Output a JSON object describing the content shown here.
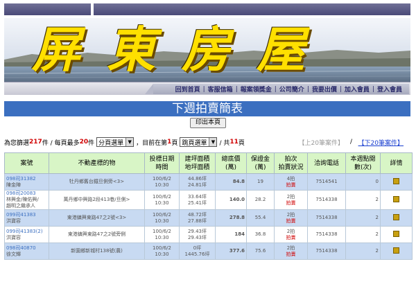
{
  "banner": {
    "title": "屏東房屋"
  },
  "nav": {
    "items": [
      "回到首頁",
      "客服信箱",
      "報案領獎金",
      "公司簡介",
      "我要出價",
      "加入會員",
      "登入會員"
    ]
  },
  "heading": "下週拍賣簡表",
  "print_button": "印出本頁",
  "info": {
    "prefix": "為您篩選",
    "total": "217",
    "mid1": "件 / 每頁最多",
    "per_page": "20",
    "mid2": "件",
    "page_select": "分頁選單",
    "mid3": "，目前在第",
    "current_page": "1",
    "mid4": "頁",
    "jump_select": "跳頁選單",
    "mid5": "/ 共",
    "total_pages": "11",
    "mid6": "頁",
    "prev": "【上20筆案件】",
    "sep": "/",
    "next": "【下20筆案件】"
  },
  "table": {
    "headers": [
      "案號",
      "不動產標的物",
      "投標日期\n時間",
      "建坪面積\n地坪面積",
      "總底價\n(萬)",
      "保證金\n(萬)",
      "拍次\n拍賣狀況",
      "洽詢電話",
      "本週點閱\n數(次)",
      "詳情"
    ],
    "rows": [
      {
        "case": "098司31382",
        "owner": "陳金陣",
        "property": "牡丹鄉舊台鐵旦側旁<3>",
        "date": "100/6/2",
        "time": "10:30",
        "build": "44.86坪",
        "land": "24.81坪",
        "price": "84.8",
        "deposit": "19",
        "round": "4拍",
        "status": "拍賣",
        "phone": "7514541",
        "visits": "0"
      },
      {
        "case": "098司20083",
        "owner": "林興金/陳佑興/\n趙明之繼承人",
        "property": "萬丹鄉中興路2段413巷/旦側>",
        "date": "100/6/2",
        "time": "10:30",
        "build": "33.64坪",
        "land": "25.41坪",
        "price": "140.0",
        "deposit": "28.2",
        "round": "2拍",
        "status": "拍賣",
        "phone": "7514338",
        "visits": "2"
      },
      {
        "case": "099司41383",
        "owner": "洪寶容",
        "property": "東港鎮興東路47之2號<3>",
        "date": "100/6/2",
        "time": "10:30",
        "build": "48.72坪",
        "land": "27.88坪",
        "price": "278.8",
        "deposit": "55.4",
        "round": "2拍",
        "status": "拍賣",
        "phone": "7514338",
        "visits": "2"
      },
      {
        "case": "099司41383(2)",
        "owner": "洪寶容",
        "property": "東港鎮興東路47之2號旁側",
        "date": "100/6/2",
        "time": "10:30",
        "build": "29.43坪",
        "land": "29.43坪",
        "price": "184",
        "deposit": "36.8",
        "round": "2拍",
        "status": "拍賣",
        "phone": "7514338",
        "visits": "2"
      },
      {
        "case": "098司40870",
        "owner": "徐文輝",
        "property": "新園鄉新城村138號(農)",
        "date": "100/6/2",
        "time": "10:30",
        "build": "0坪",
        "land": "1445.76坪",
        "price": "377.6",
        "deposit": "75.6",
        "round": "2拍",
        "status": "拍賣",
        "phone": "7514338",
        "visits": "2"
      }
    ]
  }
}
